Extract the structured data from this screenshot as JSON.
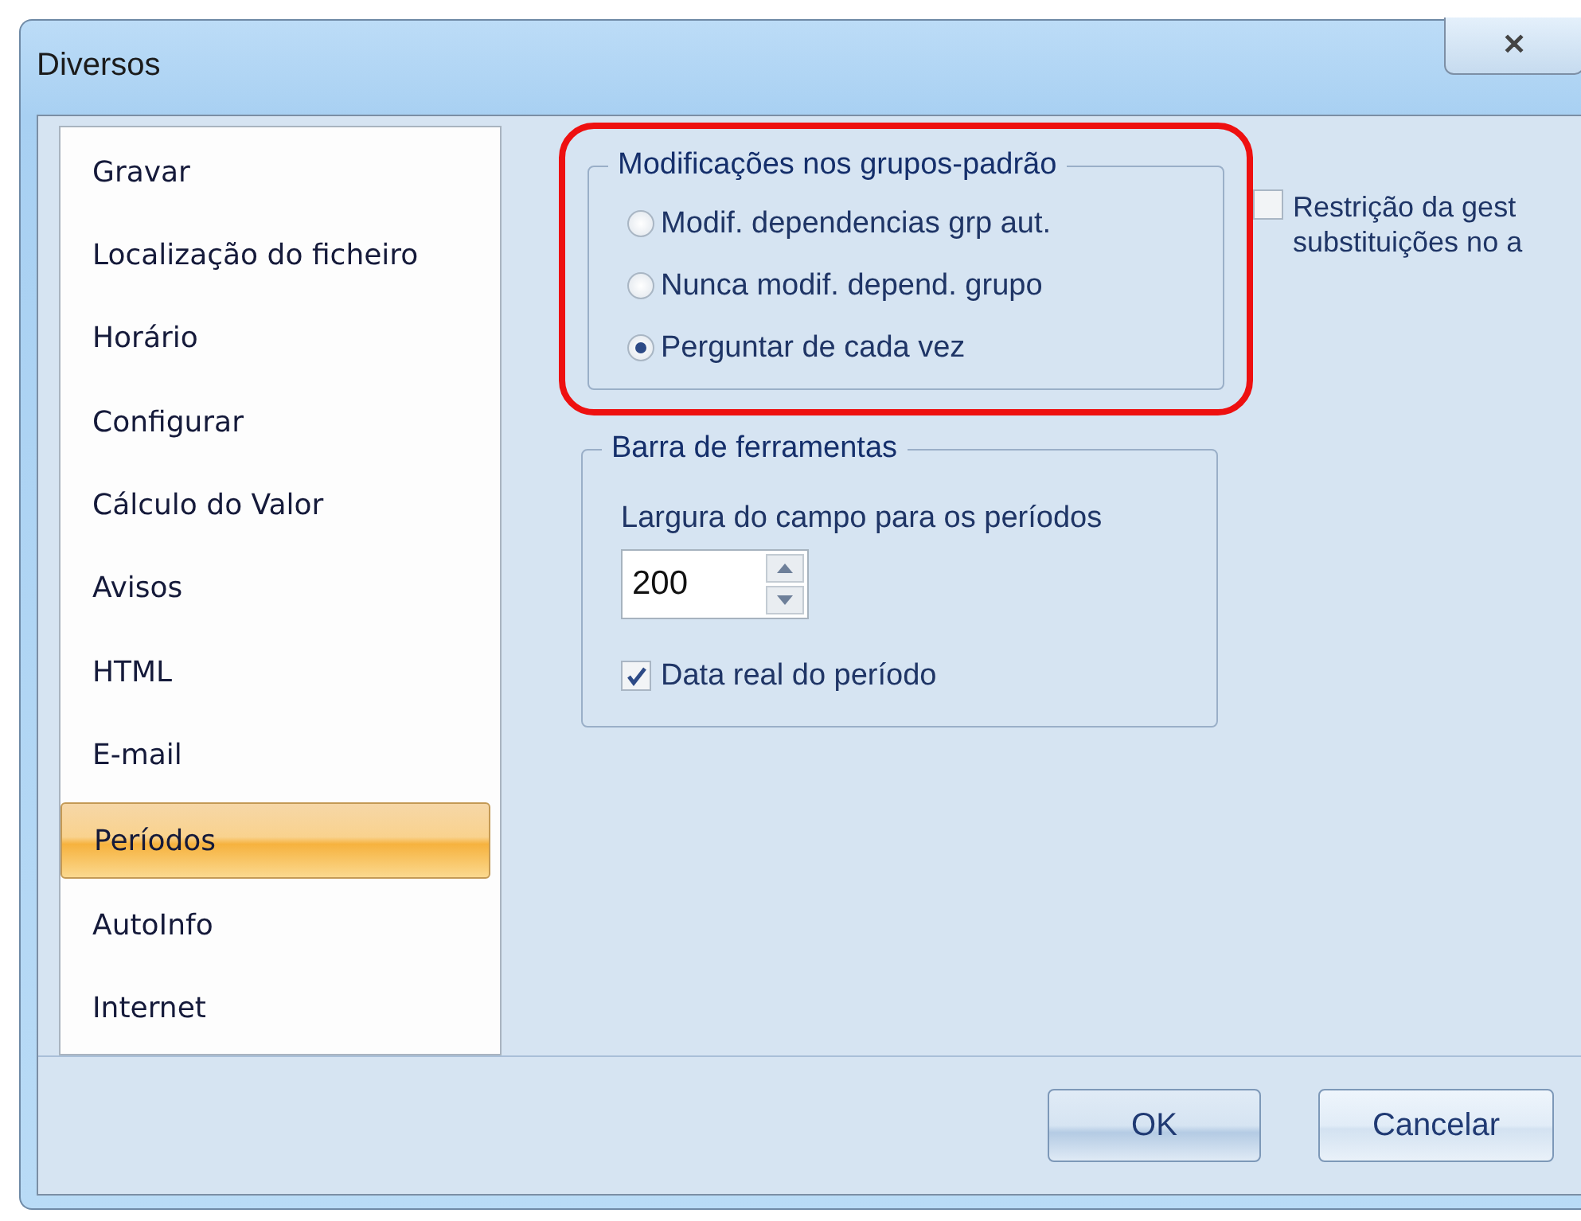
{
  "window": {
    "title": "Diversos",
    "close": "✕"
  },
  "sidebar": {
    "items": [
      {
        "label": "Gravar",
        "selected": false
      },
      {
        "label": "Localização do ficheiro",
        "selected": false
      },
      {
        "label": "Horário",
        "selected": false
      },
      {
        "label": "Configurar",
        "selected": false
      },
      {
        "label": "Cálculo do Valor",
        "selected": false
      },
      {
        "label": "Avisos",
        "selected": false
      },
      {
        "label": "HTML",
        "selected": false
      },
      {
        "label": "E-mail",
        "selected": false
      },
      {
        "label": "Períodos",
        "selected": true
      },
      {
        "label": "AutoInfo",
        "selected": false
      },
      {
        "label": "Internet",
        "selected": false
      }
    ]
  },
  "group_modifications": {
    "title": "Modificações nos grupos-padrão",
    "highlighted": true,
    "options": [
      {
        "label": "Modif. dependencias grp aut.",
        "selected": false
      },
      {
        "label": "Nunca modif. depend. grupo",
        "selected": false
      },
      {
        "label": "Perguntar de cada vez",
        "selected": true
      }
    ]
  },
  "restriction_checkbox": {
    "lines": [
      "Restrição da gest",
      "substituições no a"
    ],
    "checked": false
  },
  "group_toolbar": {
    "title": "Barra de ferramentas",
    "field_label": "Largura do campo para os períodos",
    "field_value": "200",
    "checkbox": {
      "label": "Data real do período",
      "checked": true
    }
  },
  "buttons": [
    "OK",
    "Cancelar"
  ]
}
